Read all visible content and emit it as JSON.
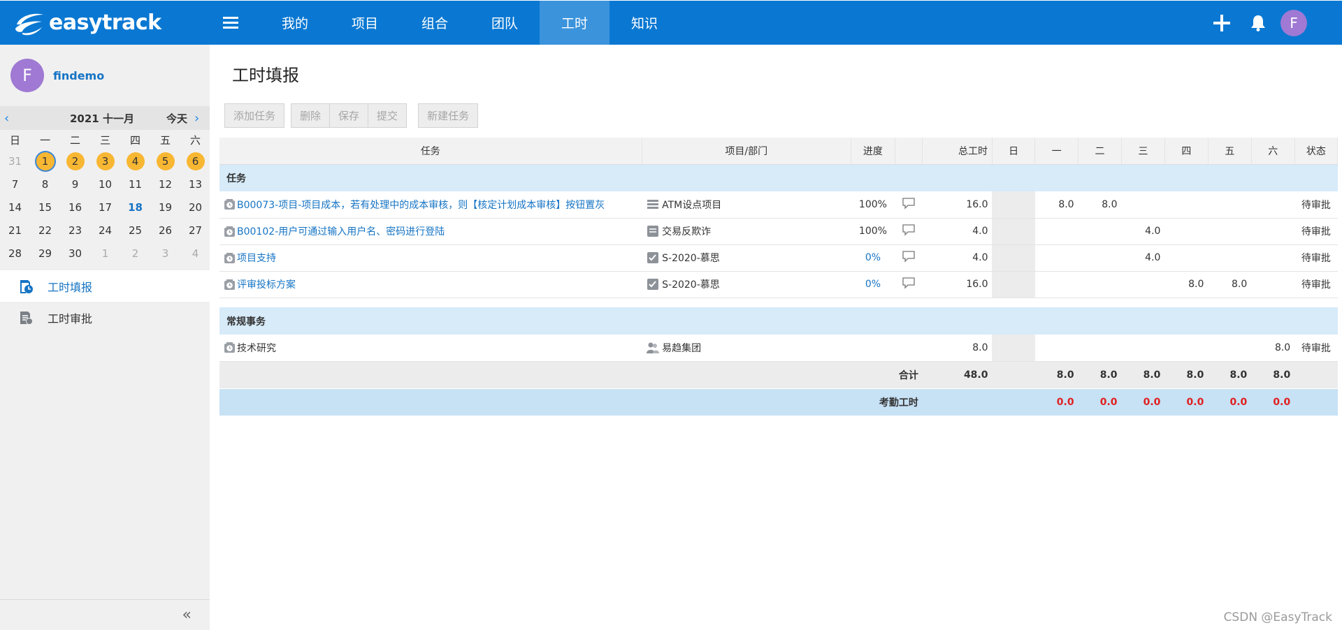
{
  "app": {
    "name": "easytrack"
  },
  "nav": {
    "items": [
      "我的",
      "项目",
      "组合",
      "团队",
      "工时",
      "知识"
    ],
    "active": "工时"
  },
  "header": {
    "avatar_letter": "F"
  },
  "user": {
    "initial": "F",
    "name": "findemo"
  },
  "calendar": {
    "title": "2021 十一月",
    "today_label": "今天",
    "weekdays": [
      "日",
      "一",
      "二",
      "三",
      "四",
      "五",
      "六"
    ],
    "weeks": [
      [
        "31",
        "1",
        "2",
        "3",
        "4",
        "5",
        "6"
      ],
      [
        "7",
        "8",
        "9",
        "10",
        "11",
        "12",
        "13"
      ],
      [
        "14",
        "15",
        "16",
        "17",
        "18",
        "19",
        "20"
      ],
      [
        "21",
        "22",
        "23",
        "24",
        "25",
        "26",
        "27"
      ],
      [
        "28",
        "29",
        "30",
        "1",
        "2",
        "3",
        "4"
      ]
    ],
    "highlighted_days": [
      "1",
      "2",
      "3",
      "4",
      "5",
      "6"
    ],
    "selected_day": "1",
    "today_day": "18"
  },
  "sidebar_menu": [
    {
      "label": "工时填报",
      "active": true
    },
    {
      "label": "工时审批",
      "active": false
    }
  ],
  "page": {
    "title": "工时填报"
  },
  "toolbar": {
    "add_task": "添加任务",
    "delete": "删除",
    "save": "保存",
    "submit": "提交",
    "new_task": "新建任务"
  },
  "table": {
    "headers": {
      "task": "任务",
      "project": "项目/部门",
      "progress": "进度",
      "total": "总工时",
      "sun": "日",
      "mon": "一",
      "tue": "二",
      "wed": "三",
      "thu": "四",
      "fri": "五",
      "sat": "六",
      "status": "状态"
    },
    "section_tasks": "任务",
    "tasks": [
      {
        "name": "B00073-项目-项目成本，若有处理中的成本审核，则【核定计划成本审核】按钮置灰",
        "project": "ATM设点项目",
        "progress": "100%",
        "total": "16.0",
        "mon": "8.0",
        "tue": "8.0",
        "status": "待审批"
      },
      {
        "name": "B00102-用户可通过输入用户名、密码进行登陆",
        "project": "交易反欺诈",
        "progress": "100%",
        "total": "4.0",
        "wed": "4.0",
        "status": "待审批"
      },
      {
        "name": "项目支持",
        "project": "S-2020-慕思",
        "progress": "0%",
        "total": "4.0",
        "wed": "4.0",
        "status": "待审批"
      },
      {
        "name": "评审投标方案",
        "project": "S-2020-慕思",
        "progress": "0%",
        "total": "16.0",
        "thu": "8.0",
        "fri": "8.0",
        "status": "待审批"
      }
    ],
    "section_routine": "常规事务",
    "routine": [
      {
        "name": "技术研究",
        "project": "易趋集团",
        "total": "8.0",
        "sat": "8.0",
        "status": "待审批"
      }
    ],
    "totals": {
      "label": "合计",
      "total": "48.0",
      "mon": "8.0",
      "tue": "8.0",
      "wed": "8.0",
      "thu": "8.0",
      "fri": "8.0",
      "sat": "8.0"
    },
    "attendance": {
      "label": "考勤工时",
      "mon": "0.0",
      "tue": "0.0",
      "wed": "0.0",
      "thu": "0.0",
      "fri": "0.0",
      "sat": "0.0"
    }
  },
  "watermark": "CSDN @EasyTrack",
  "colors": {
    "primary": "#0a78d2",
    "nav_active": "#3b93dc",
    "highlight_day": "#f8b733",
    "section_bg": "#d7ebf9",
    "attendance_bg": "#c7e1f5",
    "alert_red": "#e02020",
    "link_blue": "#1674c4"
  }
}
